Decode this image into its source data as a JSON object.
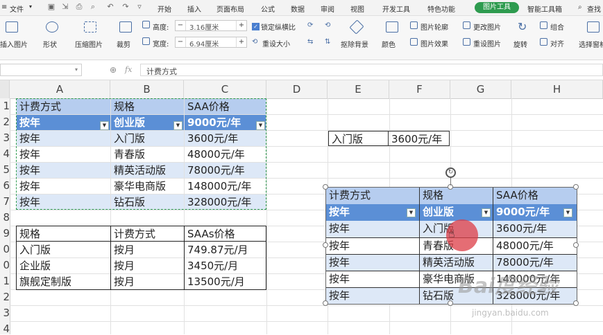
{
  "menubar": {
    "file_label": "文件",
    "tabs": [
      "开始",
      "插入",
      "页面布局",
      "公式",
      "数据",
      "审阅",
      "视图",
      "开发工具",
      "特色功能",
      "图片工具",
      "智能工具箱"
    ],
    "search_label": "查找"
  },
  "ribbon": {
    "insert_picture": "插入图片",
    "shape": "形状",
    "compress_picture": "压缩图片",
    "crop": "裁剪",
    "height_label": "高度:",
    "height_value": "3.16厘米",
    "width_label": "宽度:",
    "width_value": "6.94厘米",
    "lock_ratio": "锁定纵横比",
    "reset_size": "重设大小",
    "remove_bg": "抠除背景",
    "color": "颜色",
    "picture_outline": "图片轮廓",
    "picture_effect": "图片效果",
    "change_picture": "更改图片",
    "reset_picture": "重设图片",
    "rotate": "旋转",
    "group": "组合",
    "align": "对齐",
    "selection_pane": "选择窗格"
  },
  "formula_bar": {
    "name_box": "",
    "fx": "fx",
    "formula": "计费方式"
  },
  "columns": [
    "A",
    "B",
    "C",
    "D",
    "E",
    "F",
    "G",
    "H"
  ],
  "rows": [
    "1",
    "2",
    "3",
    "4",
    "5",
    "6",
    "7",
    "8",
    "9",
    "0",
    "1",
    "2",
    "3",
    "4",
    "5"
  ],
  "table1": {
    "header": [
      "计费方式",
      "规格",
      "SAA价格"
    ],
    "filter_row": [
      "按年",
      "创业版",
      "9000元/年"
    ],
    "body": [
      [
        "按年",
        "入门版",
        "3600元/年"
      ],
      [
        "按年",
        "青春版",
        "48000元/年"
      ],
      [
        "按年",
        "精英活动版",
        "78000元/年"
      ],
      [
        "按年",
        "豪华电商版",
        "148000元/年"
      ],
      [
        "按年",
        "钻石版",
        "328000元/年"
      ]
    ]
  },
  "table2": {
    "header": [
      "规格",
      "计费方式",
      "SAAs价格"
    ],
    "body": [
      [
        "入门版",
        "按月",
        "749.87元/月"
      ],
      [
        "企业版",
        "按月",
        "3450元/月"
      ],
      [
        "旗舰定制版",
        "按月",
        "13500元/月"
      ]
    ]
  },
  "lookup": {
    "key": "入门版",
    "value": "3600元/年"
  },
  "picture_table": {
    "header": [
      "计费方式",
      "规格",
      "SAA价格"
    ],
    "filter_row": [
      "按年",
      "创业版",
      "9000元/年"
    ],
    "body": [
      [
        "按年",
        "入门版",
        "3600元/年"
      ],
      [
        "按年",
        "青春版",
        "48000元/年"
      ],
      [
        "按年",
        "精英活动版",
        "78000元/年"
      ],
      [
        "按年",
        "豪华电商版",
        "148000元/年"
      ],
      [
        "按年",
        "钻石版",
        "328000元/年"
      ]
    ]
  },
  "watermark": {
    "main": "Bai度经验",
    "sub": "jingyan.baidu.com"
  },
  "colors": {
    "accent_green": "#2e9b4f",
    "header_blue": "#5b8fd6",
    "band_blue": "#dde8f7"
  }
}
